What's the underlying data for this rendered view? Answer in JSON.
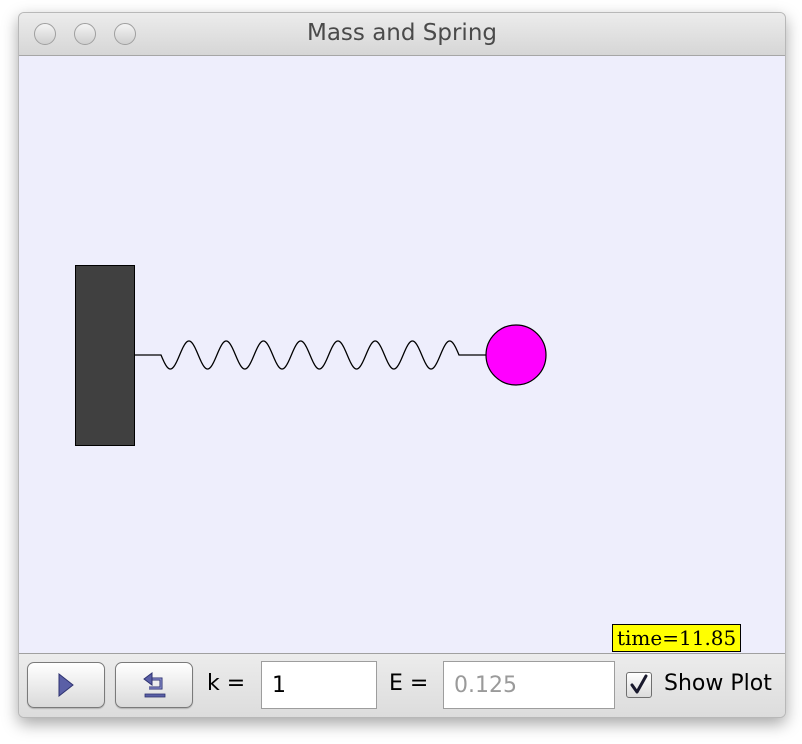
{
  "window": {
    "title": "Mass and Spring"
  },
  "simulation": {
    "time_label": "time=11.85",
    "colors": {
      "background": "#eeeefc",
      "wall": "#404040",
      "mass": "#ff00ff",
      "spring": "#000000",
      "time_bg": "#ffff00"
    }
  },
  "controls": {
    "play_icon": "play-icon",
    "reset_icon": "reset-icon",
    "k_label": "k =",
    "k_value": "1",
    "e_label": "E =",
    "e_value": "0.125",
    "show_plot_label": "Show Plot",
    "show_plot_checked": true
  }
}
